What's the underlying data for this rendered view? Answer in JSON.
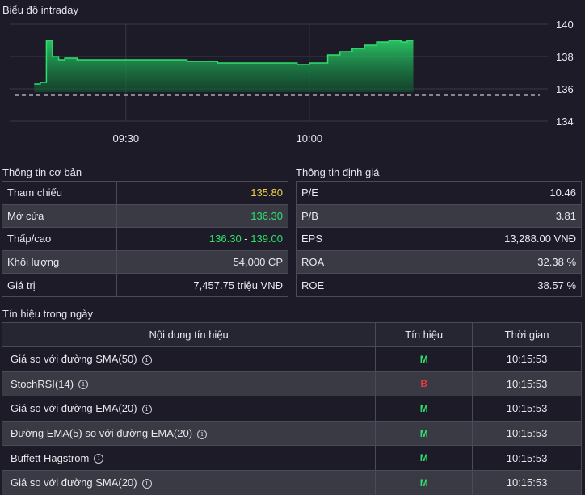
{
  "chart": {
    "title": "Biểu đồ intraday",
    "y_ticks": [
      "140",
      "138",
      "136",
      "134"
    ],
    "x_ticks": [
      "09:30",
      "10:00"
    ],
    "colors": {
      "line": "#2ee06c",
      "fill": "#1f8a4a",
      "reference": "#c8c8d0",
      "grid": "#3a3a48"
    }
  },
  "chart_data": {
    "type": "area",
    "title": "Biểu đồ intraday",
    "xlabel": "",
    "ylabel": "",
    "ylim": [
      134,
      140
    ],
    "reference_price": 135.8,
    "x": [
      "09:15",
      "09:16",
      "09:17",
      "09:18",
      "09:19",
      "09:20",
      "09:22",
      "09:25",
      "09:30",
      "09:40",
      "09:45",
      "09:55",
      "09:58",
      "10:00",
      "10:03",
      "10:05",
      "10:07",
      "10:09",
      "10:11",
      "10:13",
      "10:15",
      "10:16",
      "10:17"
    ],
    "values": [
      136.3,
      136.4,
      139.0,
      138.0,
      137.8,
      137.9,
      137.8,
      137.8,
      137.8,
      137.7,
      137.6,
      137.6,
      137.5,
      137.6,
      138.1,
      138.3,
      138.5,
      138.7,
      138.9,
      139.0,
      138.9,
      139.0,
      139.0
    ]
  },
  "basic_info": {
    "title": "Thông tin cơ bản",
    "rows": [
      {
        "label": "Tham chiếu",
        "value": "135.80"
      },
      {
        "label": "Mở cửa",
        "value": "136.30"
      },
      {
        "label": "Thấp/cao",
        "low": "136.30",
        "sep": " - ",
        "high": "139.00"
      },
      {
        "label": "Khối lượng",
        "value": "54,000 CP"
      },
      {
        "label": "Giá trị",
        "value": "7,457.75 triệu VNĐ"
      }
    ]
  },
  "valuation": {
    "title": "Thông tin định giá",
    "rows": [
      {
        "label": "P/E",
        "value": "10.46"
      },
      {
        "label": "P/B",
        "value": "3.81"
      },
      {
        "label": "EPS",
        "value": "13,288.00 VNĐ"
      },
      {
        "label": "ROA",
        "value": "32.38 %"
      },
      {
        "label": "ROE",
        "value": "38.57 %"
      }
    ]
  },
  "signals": {
    "title": "Tín hiệu trong ngày",
    "headers": [
      "Nội dung tín hiệu",
      "Tín hiệu",
      "Thời gian"
    ],
    "rows": [
      {
        "name": "Giá so với đường SMA(50)",
        "signal": "M",
        "time": "10:15:53"
      },
      {
        "name": "StochRSI(14)",
        "signal": "B",
        "time": "10:15:53"
      },
      {
        "name": "Giá so với đường EMA(20)",
        "signal": "M",
        "time": "10:15:53"
      },
      {
        "name": "Đường EMA(5) so với đường EMA(20)",
        "signal": "M",
        "time": "10:15:53"
      },
      {
        "name": "Buffett Hagstrom",
        "signal": "M",
        "time": "10:15:53"
      },
      {
        "name": "Giá so với đường SMA(20)",
        "signal": "M",
        "time": "10:15:53"
      }
    ]
  }
}
